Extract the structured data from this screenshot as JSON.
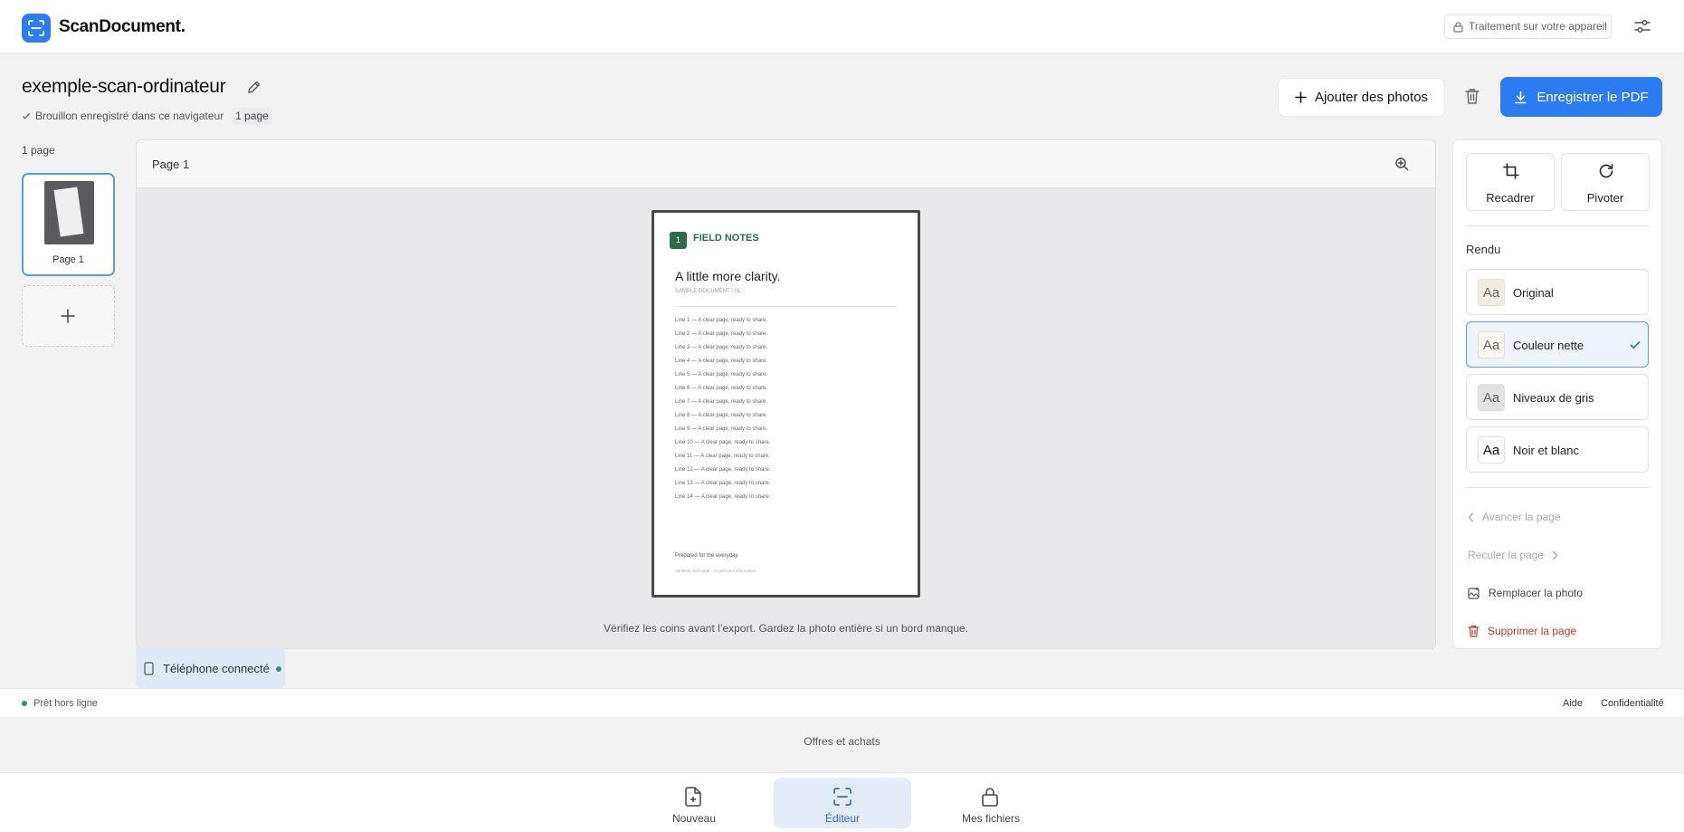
{
  "header": {
    "brand": "ScanDocument.",
    "device_badge": "Traitement sur votre appareil"
  },
  "document": {
    "title": "exemple-scan-ordinateur",
    "draft_status": "Brouillon enregistré dans ce navigateur",
    "page_count_pill": "1 page"
  },
  "actions": {
    "add_photos": "Ajouter des photos",
    "save_pdf": "Enregistrer le PDF"
  },
  "sidebar": {
    "count": "1 page",
    "pages": [
      {
        "label": "Page 1"
      }
    ]
  },
  "editor": {
    "title": "Page 1",
    "hint": "Vérifiez les coins avant l’export. Gardez la photo entière si un bord manque."
  },
  "scan": {
    "badge": "1",
    "kicker": "FIELD NOTES",
    "heading": "A little more clarity.",
    "sub": "SAMPLE DOCUMENT / 01",
    "lines": [
      "Line 1 — A clear page, ready to share.",
      "Line 2 — A clear page, ready to share.",
      "Line 3 — A clear page, ready to share.",
      "Line 4 — A clear page, ready to share.",
      "Line 5 — A clear page, ready to share.",
      "Line 6 — A clear page, ready to share.",
      "Line 7 — A clear page, ready to share.",
      "Line 8 — A clear page, ready to share.",
      "Line 9 — A clear page, ready to share.",
      "Line 10 — A clear page, ready to share.",
      "Line 11 — A clear page, ready to share.",
      "Line 12 — A clear page, ready to share.",
      "Line 13 — A clear page, ready to share.",
      "Line 14 — A clear page, ready to share."
    ],
    "footer": "Prepared for the everyday.",
    "footnote": "Synthetic test page · no personal information"
  },
  "phone": {
    "label": "Téléphone connecté"
  },
  "panel": {
    "crop": "Recadrer",
    "rotate": "Pivoter",
    "rendu_title": "Rendu",
    "glyph": "Aa",
    "renders": [
      {
        "label": "Original",
        "selected": false
      },
      {
        "label": "Couleur nette",
        "selected": true
      },
      {
        "label": "Niveaux de gris",
        "selected": false
      },
      {
        "label": "Noir et blanc",
        "selected": false
      }
    ],
    "forward": "Avancer la page",
    "backward": "Reculer la page",
    "replace": "Remplacer la photo",
    "delete": "Supprimer la page"
  },
  "status": {
    "text": "Prêt hors ligne",
    "help": "Aide",
    "privacy": "Confidentialité"
  },
  "offers": "Offres et achats",
  "nav": {
    "new": "Nouveau",
    "editor": "Éditeur",
    "files": "Mes fichiers"
  },
  "colors": {
    "accent": "#2a7cf0",
    "scan_green": "#2e6b49",
    "danger": "#c0392b",
    "online": "#3a8f6a"
  }
}
